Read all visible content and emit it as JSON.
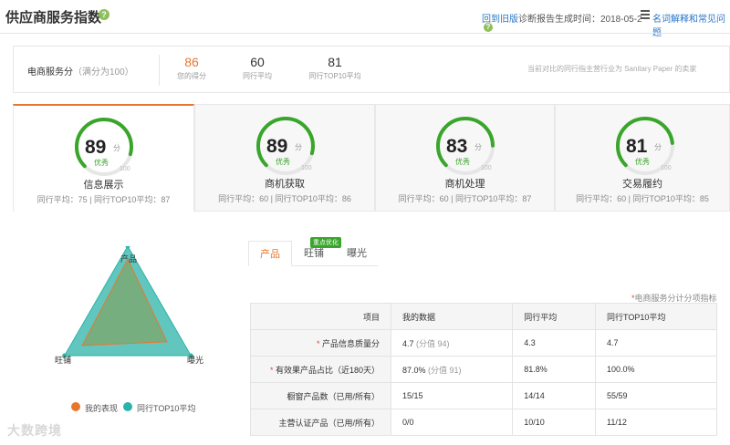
{
  "header": {
    "title": "供应商服务指数",
    "back_link": "回到旧版",
    "report_time": "诊断报告生成时间：2018-05-2",
    "faq_link": "名词解释和常见问题"
  },
  "summary": {
    "label": "电商服务分",
    "label_note": "（满分为100）",
    "metrics": [
      {
        "value": "86",
        "label": "您的得分"
      },
      {
        "value": "60",
        "label": "同行平均"
      },
      {
        "value": "81",
        "label": "同行TOP10平均"
      }
    ],
    "note": "当前对比的同行指主营行业为 Sanitary Paper 的卖家"
  },
  "cards": [
    {
      "score": "89",
      "score_value": 89,
      "unit": "分",
      "rating": "优秀",
      "max": "100",
      "title": "信息展示",
      "stats": "同行平均：75 | 同行TOP10平均：87"
    },
    {
      "score": "89",
      "score_value": 89,
      "unit": "分",
      "rating": "优秀",
      "max": "100",
      "title": "商机获取",
      "stats": "同行平均：60 | 同行TOP10平均：86"
    },
    {
      "score": "83",
      "score_value": 83,
      "unit": "分",
      "rating": "优秀",
      "max": "100",
      "title": "商机处理",
      "stats": "同行平均：60 | 同行TOP10平均：87"
    },
    {
      "score": "81",
      "score_value": 81,
      "unit": "分",
      "rating": "优秀",
      "max": "100",
      "title": "交易履约",
      "stats": "同行平均：60 | 同行TOP10平均：85"
    }
  ],
  "radar": {
    "axes": [
      "产品",
      "曝光",
      "旺铺"
    ],
    "legend": [
      {
        "name": "我的表现",
        "color": "#e8772e"
      },
      {
        "name": "同行TOP10平均",
        "color": "#2bb3a8"
      }
    ],
    "my_performance": [
      0.82,
      0.62,
      0.72
    ],
    "top10_average": [
      1.0,
      1.0,
      1.0
    ]
  },
  "tabs": [
    {
      "label": "产品",
      "active": true
    },
    {
      "label": "旺铺",
      "active": false
    },
    {
      "label": "曝光",
      "active": false
    }
  ],
  "tab_badge": "重点优化",
  "footnote": "电商服务分计分项指标",
  "table": {
    "headers": [
      "项目",
      "我的数据",
      "同行平均",
      "同行TOP10平均"
    ],
    "rows": [
      {
        "label": "产品信息质量分",
        "required": true,
        "mine": "4.7",
        "mine_note": "(分值 94)",
        "avg": "4.3",
        "top10": "4.7"
      },
      {
        "label": "有效果产品占比（近180天）",
        "required": true,
        "mine": "87.0%",
        "mine_note": "(分值 91)",
        "avg": "81.8%",
        "top10": "100.0%"
      },
      {
        "label": "橱窗产品数（已用/所有）",
        "required": false,
        "mine": "15/15",
        "mine_note": "",
        "avg": "14/14",
        "top10": "55/59"
      },
      {
        "label": "主营认证产品（已用/所有）",
        "required": false,
        "mine": "0/0",
        "mine_note": "",
        "avg": "10/10",
        "top10": "11/12"
      }
    ]
  },
  "colors": {
    "accent": "#e8772e",
    "gauge": "#3aa52b",
    "link": "#2a76c6"
  },
  "watermark": "大数跨境"
}
